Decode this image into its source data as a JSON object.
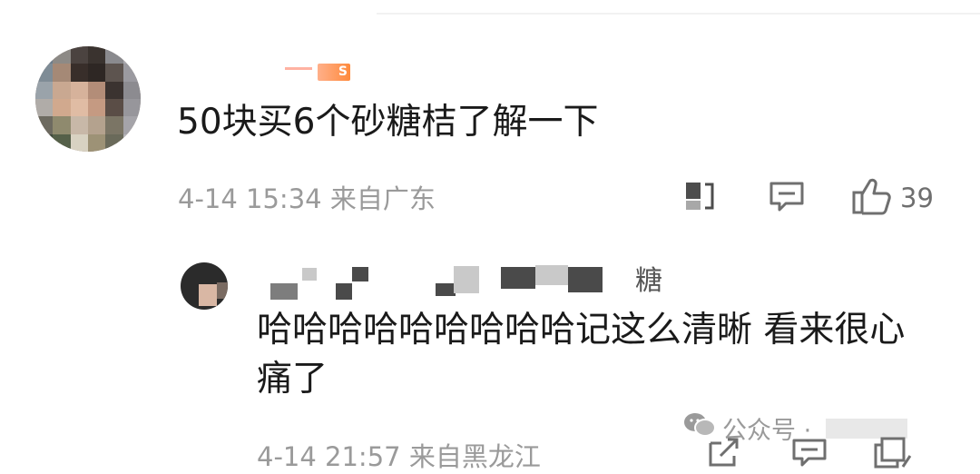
{
  "comment": {
    "level_badge": "S",
    "text": "50块买6个砂糖桔了解一下",
    "meta": "4-14 15:34 来自广东",
    "like_count": "39"
  },
  "reply": {
    "name_tail": "糖",
    "text": "哈哈哈哈哈哈哈哈哈记这么清晰 看来很心痛了",
    "meta": "4-14 21:57 来自黑龙江"
  },
  "watermark": {
    "text": "公众号 ·"
  },
  "icons": [
    "share-icon",
    "comment-icon",
    "like-icon",
    "wechat-icon"
  ]
}
